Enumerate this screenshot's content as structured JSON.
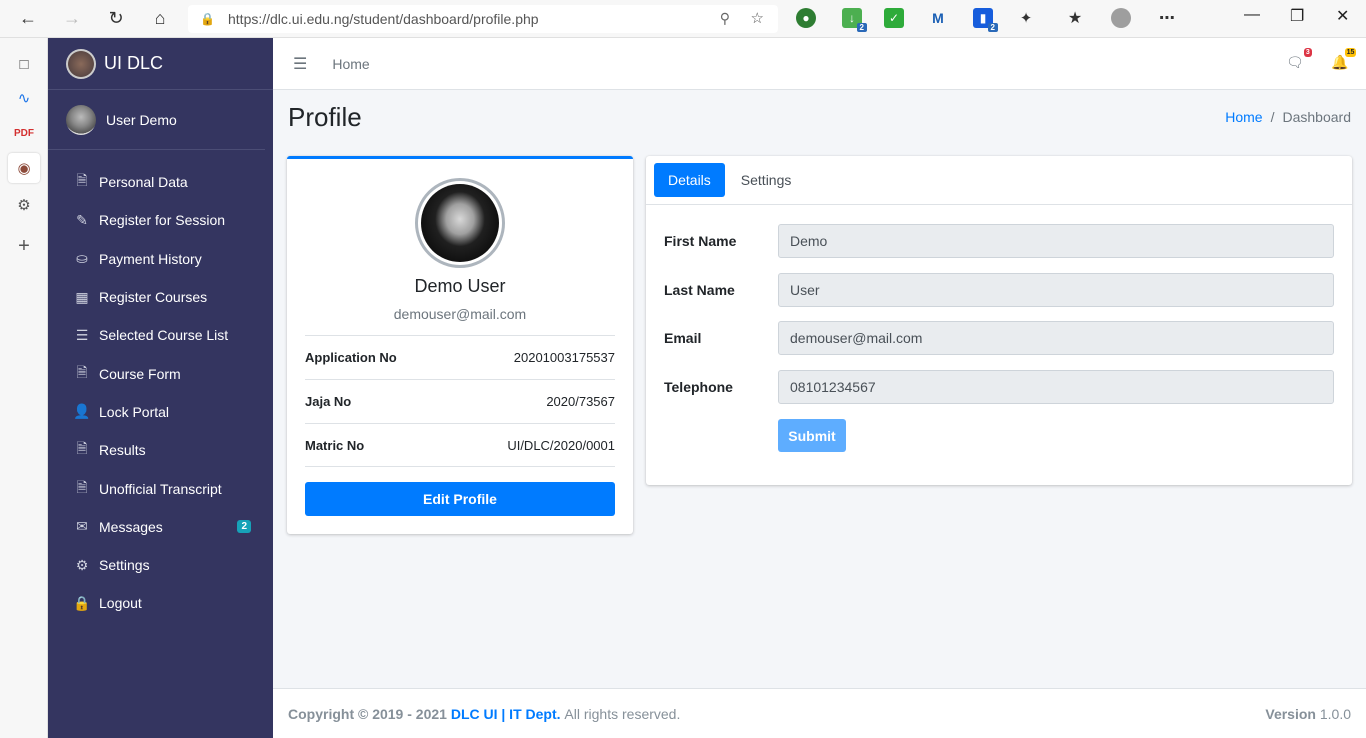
{
  "browser": {
    "url": "https://dlc.ui.edu.ng/student/dashboard/profile.php",
    "ext_badges": {
      "download": "2",
      "bitwarden": "2"
    }
  },
  "sidebar": {
    "brand": "UI DLC",
    "user": "User Demo",
    "items": [
      {
        "label": "Personal Data",
        "icon": "file-icon"
      },
      {
        "label": "Register for Session",
        "icon": "edit-icon"
      },
      {
        "label": "Payment History",
        "icon": "coins-icon"
      },
      {
        "label": "Register Courses",
        "icon": "book-icon"
      },
      {
        "label": "Selected Course List",
        "icon": "list-icon"
      },
      {
        "label": "Course Form",
        "icon": "file-pdf-icon"
      },
      {
        "label": "Lock Portal",
        "icon": "user-lock-icon"
      },
      {
        "label": "Results",
        "icon": "file-icon"
      },
      {
        "label": "Unofficial Transcript",
        "icon": "file-pdf-icon"
      },
      {
        "label": "Messages",
        "icon": "envelope-icon",
        "badge": "2"
      },
      {
        "label": "Settings",
        "icon": "gear-icon"
      },
      {
        "label": "Logout",
        "icon": "lock-icon"
      }
    ]
  },
  "topnav": {
    "home": "Home",
    "messages_count": "3",
    "notifications_count": "15"
  },
  "header": {
    "title": "Profile",
    "breadcrumb_home": "Home",
    "breadcrumb_current": "Dashboard"
  },
  "profile": {
    "name": "Demo User",
    "email": "demouser@mail.com",
    "rows": [
      {
        "label": "Application No",
        "value": "20201003175537"
      },
      {
        "label": "Jaja No",
        "value": "2020/73567"
      },
      {
        "label": "Matric No",
        "value": "UI/DLC/2020/0001"
      }
    ],
    "edit_button": "Edit Profile"
  },
  "details": {
    "tabs": [
      "Details",
      "Settings"
    ],
    "fields": [
      {
        "label": "First Name",
        "value": "Demo"
      },
      {
        "label": "Last Name",
        "value": "User"
      },
      {
        "label": "Email",
        "value": "demouser@mail.com"
      },
      {
        "label": "Telephone",
        "value": "08101234567"
      }
    ],
    "submit": "Submit"
  },
  "footer": {
    "copyright": "Copyright © 2019 - 2021",
    "org": "DLC UI | IT Dept.",
    "rights": "All rights reserved.",
    "version_label": "Version",
    "version": "1.0.0"
  },
  "colors": {
    "sidebar_bg": "#343560",
    "primary": "#007bff",
    "submit_disabled": "#5eadff"
  }
}
